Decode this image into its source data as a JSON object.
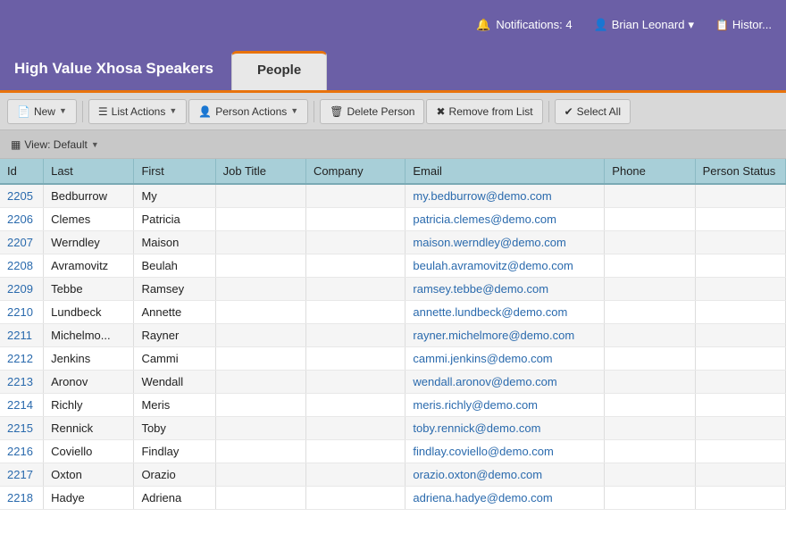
{
  "topbar": {
    "notifications_label": "Notifications: 4",
    "user_label": "Brian Leonard",
    "user_arrow": "▾",
    "history_label": "Histor..."
  },
  "tabs": {
    "list_title": "High Value Xhosa Speakers",
    "active_tab": "People"
  },
  "toolbar": {
    "new_label": "New",
    "list_actions_label": "List Actions",
    "person_actions_label": "Person Actions",
    "delete_label": "Delete Person",
    "remove_label": "Remove from List",
    "select_all_label": "Select All"
  },
  "view_bar": {
    "label": "View: Default"
  },
  "table": {
    "columns": [
      "Id",
      "Last",
      "First",
      "Job Title",
      "Company",
      "Email",
      "Phone",
      "Person Status"
    ],
    "rows": [
      {
        "id": "2205",
        "last": "Bedburrow",
        "first": "My",
        "title": "",
        "company": "",
        "email": "my.bedburrow@demo.com",
        "phone": "",
        "status": ""
      },
      {
        "id": "2206",
        "last": "Clemes",
        "first": "Patricia",
        "title": "",
        "company": "",
        "email": "patricia.clemes@demo.com",
        "phone": "",
        "status": ""
      },
      {
        "id": "2207",
        "last": "Werndley",
        "first": "Maison",
        "title": "",
        "company": "",
        "email": "maison.werndley@demo.com",
        "phone": "",
        "status": ""
      },
      {
        "id": "2208",
        "last": "Avramovitz",
        "first": "Beulah",
        "title": "",
        "company": "",
        "email": "beulah.avramovitz@demo.com",
        "phone": "",
        "status": ""
      },
      {
        "id": "2209",
        "last": "Tebbe",
        "first": "Ramsey",
        "title": "",
        "company": "",
        "email": "ramsey.tebbe@demo.com",
        "phone": "",
        "status": ""
      },
      {
        "id": "2210",
        "last": "Lundbeck",
        "first": "Annette",
        "title": "",
        "company": "",
        "email": "annette.lundbeck@demo.com",
        "phone": "",
        "status": ""
      },
      {
        "id": "2211",
        "last": "Michelmo...",
        "first": "Rayner",
        "title": "",
        "company": "",
        "email": "rayner.michelmore@demo.com",
        "phone": "",
        "status": ""
      },
      {
        "id": "2212",
        "last": "Jenkins",
        "first": "Cammi",
        "title": "",
        "company": "",
        "email": "cammi.jenkins@demo.com",
        "phone": "",
        "status": ""
      },
      {
        "id": "2213",
        "last": "Aronov",
        "first": "Wendall",
        "title": "",
        "company": "",
        "email": "wendall.aronov@demo.com",
        "phone": "",
        "status": ""
      },
      {
        "id": "2214",
        "last": "Richly",
        "first": "Meris",
        "title": "",
        "company": "",
        "email": "meris.richly@demo.com",
        "phone": "",
        "status": ""
      },
      {
        "id": "2215",
        "last": "Rennick",
        "first": "Toby",
        "title": "",
        "company": "",
        "email": "toby.rennick@demo.com",
        "phone": "",
        "status": ""
      },
      {
        "id": "2216",
        "last": "Coviello",
        "first": "Findlay",
        "title": "",
        "company": "",
        "email": "findlay.coviello@demo.com",
        "phone": "",
        "status": ""
      },
      {
        "id": "2217",
        "last": "Oxton",
        "first": "Orazio",
        "title": "",
        "company": "",
        "email": "orazio.oxton@demo.com",
        "phone": "",
        "status": ""
      },
      {
        "id": "2218",
        "last": "Hadye",
        "first": "Adriena",
        "title": "",
        "company": "",
        "email": "adriena.hadye@demo.com",
        "phone": "",
        "status": ""
      }
    ]
  }
}
